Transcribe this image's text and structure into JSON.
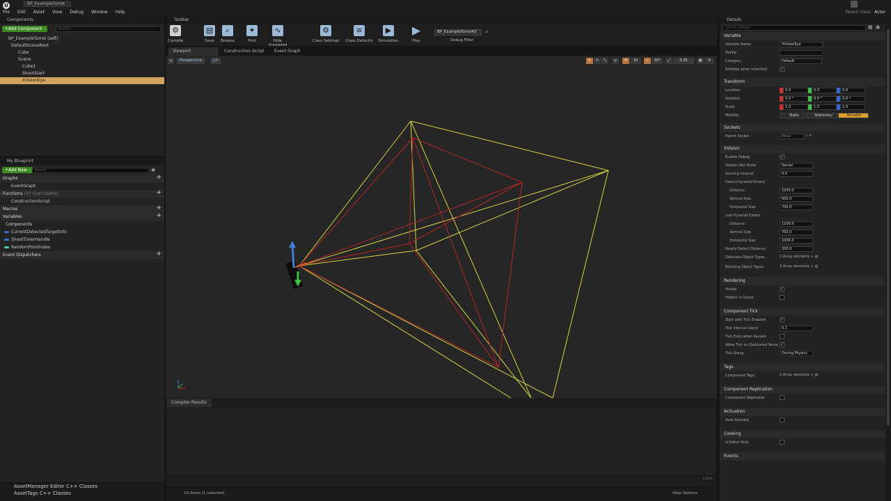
{
  "window": {
    "tab_title": "BP_ExampleTurret",
    "parent_class_label": "Parent class:",
    "parent_class_value": "Actor",
    "logo": "U"
  },
  "menu": [
    "File",
    "Edit",
    "Asset",
    "View",
    "Debug",
    "Window",
    "Help"
  ],
  "components_panel": {
    "title": "Components",
    "add_button": "+Add Component -",
    "search_placeholder": "Search",
    "tree": [
      "BP_ExampleTurret (self)",
      "DefaultSceneRoot",
      "Cube",
      "Scene",
      "Cube1",
      "ShootStart",
      "XVisionEye"
    ]
  },
  "my_blueprint": {
    "title": "My Blueprint",
    "add_button": "+Add New -",
    "search_placeholder": "Search",
    "graphs_label": "Graphs",
    "event_graph": "EventGraph",
    "functions_label": "Functions",
    "functions_count": "(20 Overridable)",
    "construction_script": "ConstructionScript",
    "macros_label": "Macros",
    "variables_label": "Variables",
    "components_label": "Components",
    "variables": [
      {
        "name": "CurrentDetectedTargetInfo",
        "color": "#3f6fd4"
      },
      {
        "name": "ShootTimerHandle",
        "color": "#3f6fd4"
      },
      {
        "name": "RandomPointIndex",
        "color": "#3ad4a0"
      }
    ],
    "event_dispatchers_label": "Event Dispatchers"
  },
  "toolbar": {
    "title": "Toolbar",
    "buttons": [
      {
        "label": "Compile",
        "icon": "gear-icon"
      },
      {
        "label": "Save",
        "icon": "save-icon"
      },
      {
        "label": "Browse",
        "icon": "search-icon"
      },
      {
        "label": "Find",
        "icon": "find-icon"
      },
      {
        "label": "Hide Unrelated",
        "icon": "hide-icon"
      },
      {
        "label": "Class Settings",
        "icon": "settings-icon"
      },
      {
        "label": "Class Defaults",
        "icon": "defaults-icon"
      },
      {
        "label": "Simulation",
        "icon": "simulation-icon"
      },
      {
        "label": "Play",
        "icon": "play-icon"
      }
    ],
    "debug_object": "BP_ExampleTurret42",
    "debug_filter_label": "Debug Filter"
  },
  "tabs": [
    "Viewport",
    "Construction Script",
    "Event Graph"
  ],
  "viewport": {
    "perspective": "Perspective",
    "lit": "Lit",
    "grid_snap": "10",
    "rot_snap": "10°",
    "scale_snap": "0.25",
    "cam_speed": "4"
  },
  "compiler": {
    "title": "Compiler Results",
    "clear": "Clear"
  },
  "status": {
    "items": "10 items (1 selected)",
    "view_options": "View Options"
  },
  "content_browser": {
    "line1": "AssetManager Editor C++ Classes",
    "line2": "AssetTags C++ Classes"
  },
  "details": {
    "title": "Details",
    "search_placeholder": "Search Details",
    "variable": {
      "section": "Variable",
      "name_label": "Variable Name",
      "name_value": "XVisionEye",
      "tooltip_label": "Tooltip",
      "category_label": "Category",
      "category_value": "Default",
      "editable_label": "Editable when Inherited"
    },
    "transform": {
      "section": "Transform",
      "location_label": "Location",
      "location": [
        "0.0",
        "0.0",
        "0.0"
      ],
      "rotation_label": "Rotation",
      "rotation": [
        "0.0 °",
        "0.0 °",
        "0.0 °"
      ],
      "scale_label": "Scale",
      "scale": [
        "1.0",
        "1.0",
        "1.0"
      ],
      "mobility_label": "Mobility",
      "mobility": [
        "Static",
        "Stationary",
        "Movable"
      ]
    },
    "sockets": {
      "section": "Sockets",
      "parent_label": "Parent Socket",
      "parent_value": "None"
    },
    "xvision": {
      "section": "XVision",
      "enable_debug": "Enable Debug",
      "net_mode_label": "XVision Net Mode",
      "net_mode": "Server",
      "sensing_label": "Sensing Interval",
      "sensing": "0.0",
      "detect_label": "Detect Pyramid Extent",
      "distance_label": "Distance",
      "vertical_label": "Vertical Size",
      "horizontal_label": "Horizontal Size",
      "detect": [
        "1000.0",
        "600.0",
        "700.0"
      ],
      "lost_label": "Lost Pyramid Extent",
      "lost": [
        "1100.0",
        "700.0",
        "1000.0"
      ],
      "nearly_label": "Nearly Detect Distance",
      "nearly": "200.0",
      "detected_types_label": "Detected Object Types",
      "detected_types": "2 Array elements",
      "blocking_types_label": "Blocking Object Types",
      "blocking_types": "3 Array elements"
    },
    "rendering": {
      "section": "Rendering",
      "visible": "Visible",
      "hidden": "Hidden in Game"
    },
    "tick": {
      "section": "Component Tick",
      "start": "Start with Tick Enabled",
      "interval_label": "Tick Interval (secs)",
      "interval": "0.1",
      "paused": "Tick Even when Paused",
      "dedicated": "Allow Tick on Dedicated Serve",
      "group_label": "Tick Group",
      "group": "During Physics"
    },
    "tags": {
      "section": "Tags",
      "label": "Component Tags",
      "value": "0 Array elements"
    },
    "replication": {
      "section": "Component Replication",
      "label": "Component Replicates"
    },
    "activation": {
      "section": "Activation",
      "label": "Auto Activate"
    },
    "cooking": {
      "section": "Cooking",
      "label": "Is Editor Only"
    },
    "events": {
      "section": "Events"
    }
  }
}
